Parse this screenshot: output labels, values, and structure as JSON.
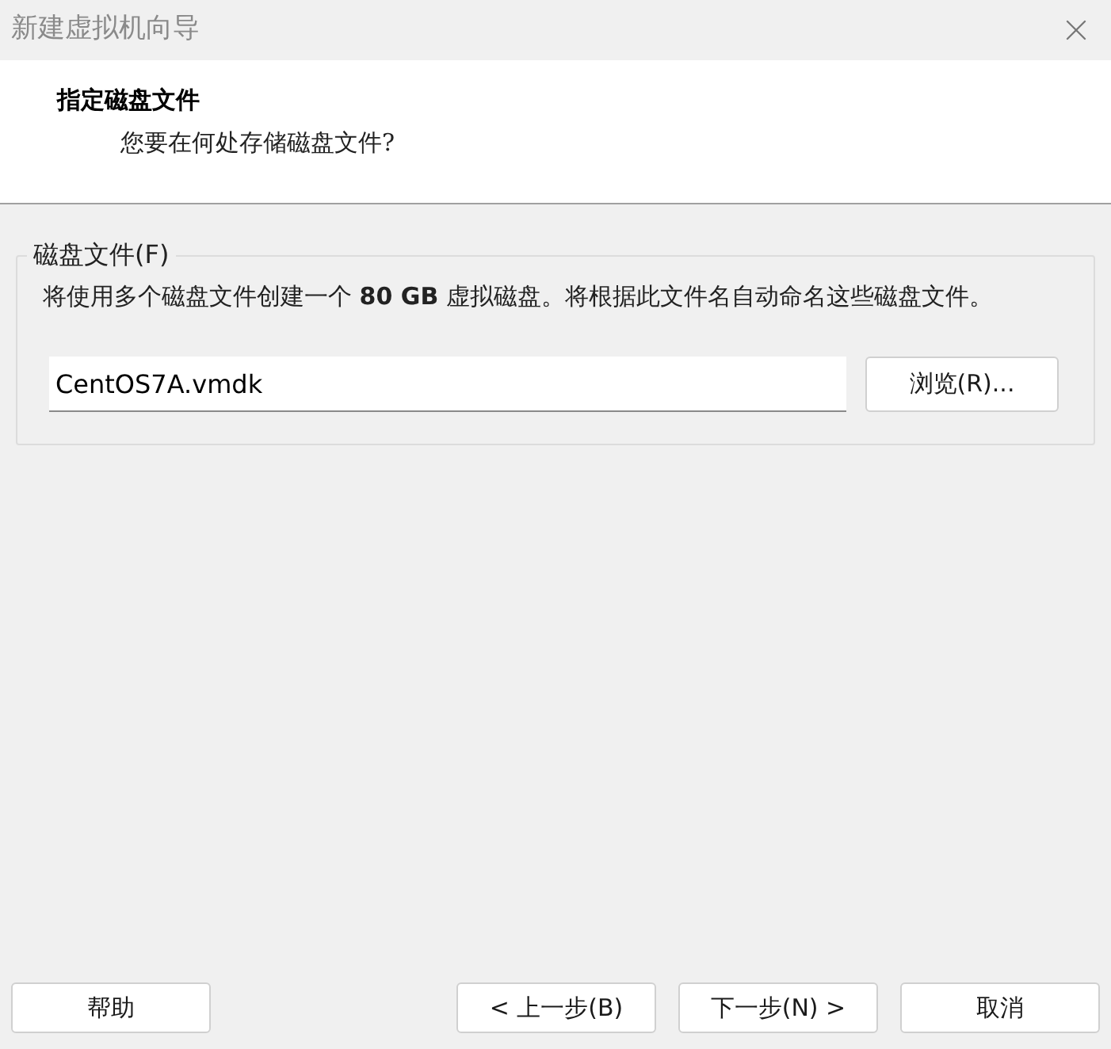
{
  "window": {
    "title": "新建虚拟机向导"
  },
  "header": {
    "title": "指定磁盘文件",
    "subtitle": "您要在何处存储磁盘文件?"
  },
  "group": {
    "legend": "磁盘文件(F)",
    "description": "将使用多个磁盘文件创建一个 **80 GB** 虚拟磁盘。将根据此文件名自动命名这些磁盘文件。",
    "file_field": {
      "value": "CentOS7A.vmdk"
    },
    "browse_button": "浏览(R)..."
  },
  "buttons": [
    "帮助",
    "< 上一步(B)",
    "下一步(N) >",
    "取消"
  ]
}
